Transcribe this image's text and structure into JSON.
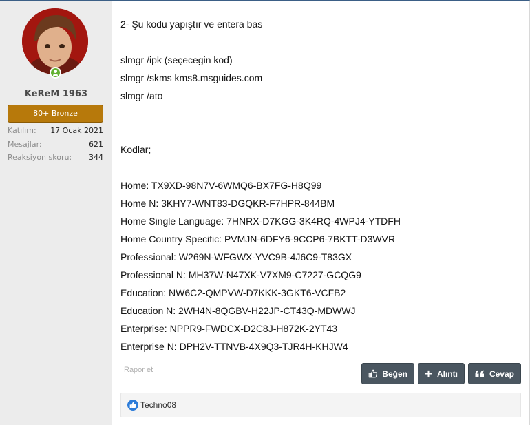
{
  "user": {
    "name": "KeReM 1963",
    "rank": "80+ Bronze",
    "stats": [
      {
        "label": "Katılım:",
        "value": "17 Ocak 2021"
      },
      {
        "label": "Mesajlar:",
        "value": "621"
      },
      {
        "label": "Reaksiyon skoru:",
        "value": "344"
      }
    ]
  },
  "post": {
    "lines": [
      "2- Şu kodu yapıştır ve entera bas",
      "",
      "slmgr /ipk (seçecegin kod)",
      "slmgr /skms kms8.msguides.com",
      "slmgr /ato",
      "",
      "",
      "Kodlar;",
      "",
      "Home: TX9XD-98N7V-6WMQ6-BX7FG-H8Q99",
      "Home N: 3KHY7-WNT83-DGQKR-F7HPR-844BM",
      "Home Single Language: 7HNRX-D7KGG-3K4RQ-4WPJ4-YTDFH",
      "Home Country Specific: PVMJN-6DFY6-9CCP6-7BKTT-D3WVR",
      "Professional: W269N-WFGWX-YVC9B-4J6C9-T83GX",
      "Professional N: MH37W-N47XK-V7XM9-C7227-GCQG9",
      "Education: NW6C2-QMPVW-D7KKK-3GKT6-VCFB2",
      "Education N: 2WH4N-8QGBV-H22JP-CT43Q-MDWWJ",
      "Enterprise: NPPR9-FWDCX-D2C8J-H872K-2YT43",
      "Enterprise N: DPH2V-TTNVB-4X9Q3-TJR4H-KHJW4"
    ]
  },
  "actions": {
    "report": "Rapor et",
    "like": "Beğen",
    "quote": "Alıntı",
    "reply": "Cevap"
  },
  "reactions": {
    "users": "Techno08"
  },
  "colors": {
    "rank_bg": "#b7790b",
    "button_bg": "#4a5660",
    "online": "#63b233",
    "like": "#2d7cd9"
  },
  "icons": [
    "user-online-icon",
    "thumbs-up-icon",
    "plus-icon",
    "quote-icon",
    "like-reaction-icon"
  ]
}
